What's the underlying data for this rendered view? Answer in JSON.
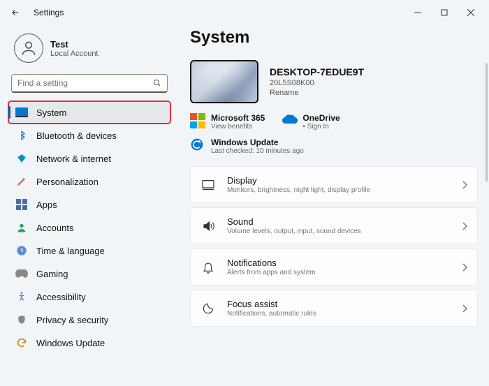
{
  "window": {
    "title": "Settings"
  },
  "account": {
    "name": "Test",
    "type": "Local Account"
  },
  "search": {
    "placeholder": "Find a setting"
  },
  "sidebar": {
    "items": [
      {
        "label": "System",
        "selected": true,
        "icon": "system"
      },
      {
        "label": "Bluetooth & devices",
        "selected": false,
        "icon": "bluetooth"
      },
      {
        "label": "Network & internet",
        "selected": false,
        "icon": "network"
      },
      {
        "label": "Personalization",
        "selected": false,
        "icon": "personalization"
      },
      {
        "label": "Apps",
        "selected": false,
        "icon": "apps"
      },
      {
        "label": "Accounts",
        "selected": false,
        "icon": "accounts"
      },
      {
        "label": "Time & language",
        "selected": false,
        "icon": "time"
      },
      {
        "label": "Gaming",
        "selected": false,
        "icon": "gaming"
      },
      {
        "label": "Accessibility",
        "selected": false,
        "icon": "accessibility"
      },
      {
        "label": "Privacy & security",
        "selected": false,
        "icon": "privacy"
      },
      {
        "label": "Windows Update",
        "selected": false,
        "icon": "update"
      }
    ]
  },
  "main": {
    "title": "System",
    "device": {
      "name": "DESKTOP-7EDUE9T",
      "model": "20L5S08K00",
      "rename_label": "Rename"
    },
    "status": {
      "ms365": {
        "title": "Microsoft 365",
        "sub": "View benefits"
      },
      "onedrive": {
        "title": "OneDrive",
        "sub": "Sign In"
      },
      "update": {
        "title": "Windows Update",
        "sub": "Last checked: 10 minutes ago"
      }
    },
    "cards": [
      {
        "title": "Display",
        "sub": "Monitors, brightness, night light, display profile",
        "icon": "display"
      },
      {
        "title": "Sound",
        "sub": "Volume levels, output, input, sound devices",
        "icon": "sound"
      },
      {
        "title": "Notifications",
        "sub": "Alerts from apps and system",
        "icon": "notifications"
      },
      {
        "title": "Focus assist",
        "sub": "Notifications, automatic rules",
        "icon": "focus"
      }
    ]
  }
}
